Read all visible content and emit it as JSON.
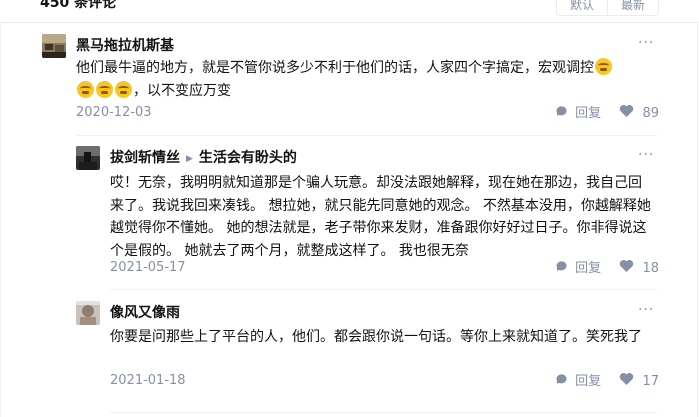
{
  "header": {
    "count_label": "450 条评论",
    "sort_default": "默认",
    "sort_latest": "最新"
  },
  "comments": [
    {
      "author": "黑马拖拉机斯基",
      "text_line1": "他们最牛逼的地方，就是不管你说多少不利于他们的话，人家四个字搞定，宏观调控",
      "text_line2": "，以不变应万变",
      "emoji": "doge-emoji",
      "date": "2020-12-03",
      "reply_label": "回复",
      "likes": "89"
    },
    {
      "author": "拔剑斩情丝",
      "reply_to": "生活会有盼头的",
      "text": "哎！无奈，我明明就知道那是个骗人玩意。却没法跟她解释，现在她在那边，我自己回来了。我说我回来凑钱。 想拉她，就只能先同意她的观念。 不然基本没用，你越解释她越觉得你不懂她。 她的想法就是，老子带你来发财，准备跟你好好过日子。你非得说这个是假的。 她就去了两个月，就整成这样了。 我也很无奈",
      "date": "2021-05-17",
      "reply_label": "回复",
      "likes": "18"
    },
    {
      "author": "像风又像雨",
      "text": "你要是问那些上了平台的人，他们。都会跟你说一句话。等你上来就知道了。笑死我了",
      "date": "2021-01-18",
      "reply_label": "回复",
      "likes": "17"
    }
  ],
  "colors": {
    "text": "#121212",
    "meta": "#8590a6",
    "divider": "#f0f0f0"
  }
}
